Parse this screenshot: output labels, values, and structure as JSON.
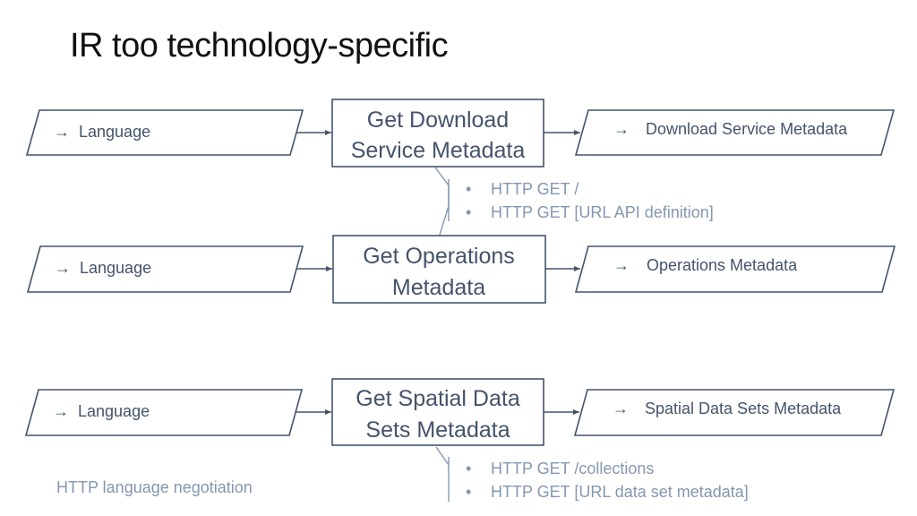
{
  "slide": {
    "title": "IR too technology-specific",
    "colors": {
      "stroke": "#44546a",
      "text": "#44546a",
      "note_text": "#8497b0",
      "note_line": "#8497b0",
      "title": "#111111"
    }
  },
  "rows": [
    {
      "input": {
        "arrow": "→",
        "label": "Language"
      },
      "process": {
        "lines": [
          "Get Download",
          "Service Metadata"
        ]
      },
      "output": {
        "arrow": "→",
        "label": "Download Service Metadata"
      }
    },
    {
      "input": {
        "arrow": "→",
        "label": "Language"
      },
      "process": {
        "lines": [
          "Get Operations",
          "Metadata"
        ]
      },
      "output": {
        "arrow": "→",
        "label": "Operations Metadata"
      }
    },
    {
      "input": {
        "arrow": "→",
        "label": "Language"
      },
      "process": {
        "lines": [
          "Get Spatial Data",
          "Sets Metadata"
        ]
      },
      "output": {
        "arrow": "→",
        "label": "Spatial Data Sets Metadata"
      }
    }
  ],
  "callouts": [
    {
      "bullet": "•",
      "items": [
        "HTTP GET /",
        "HTTP GET [URL API definition]"
      ]
    },
    {
      "bullet": "•",
      "items": [
        "HTTP GET /collections",
        "HTTP GET [URL data set metadata]"
      ]
    }
  ],
  "footer_note": "HTTP language negotiation"
}
